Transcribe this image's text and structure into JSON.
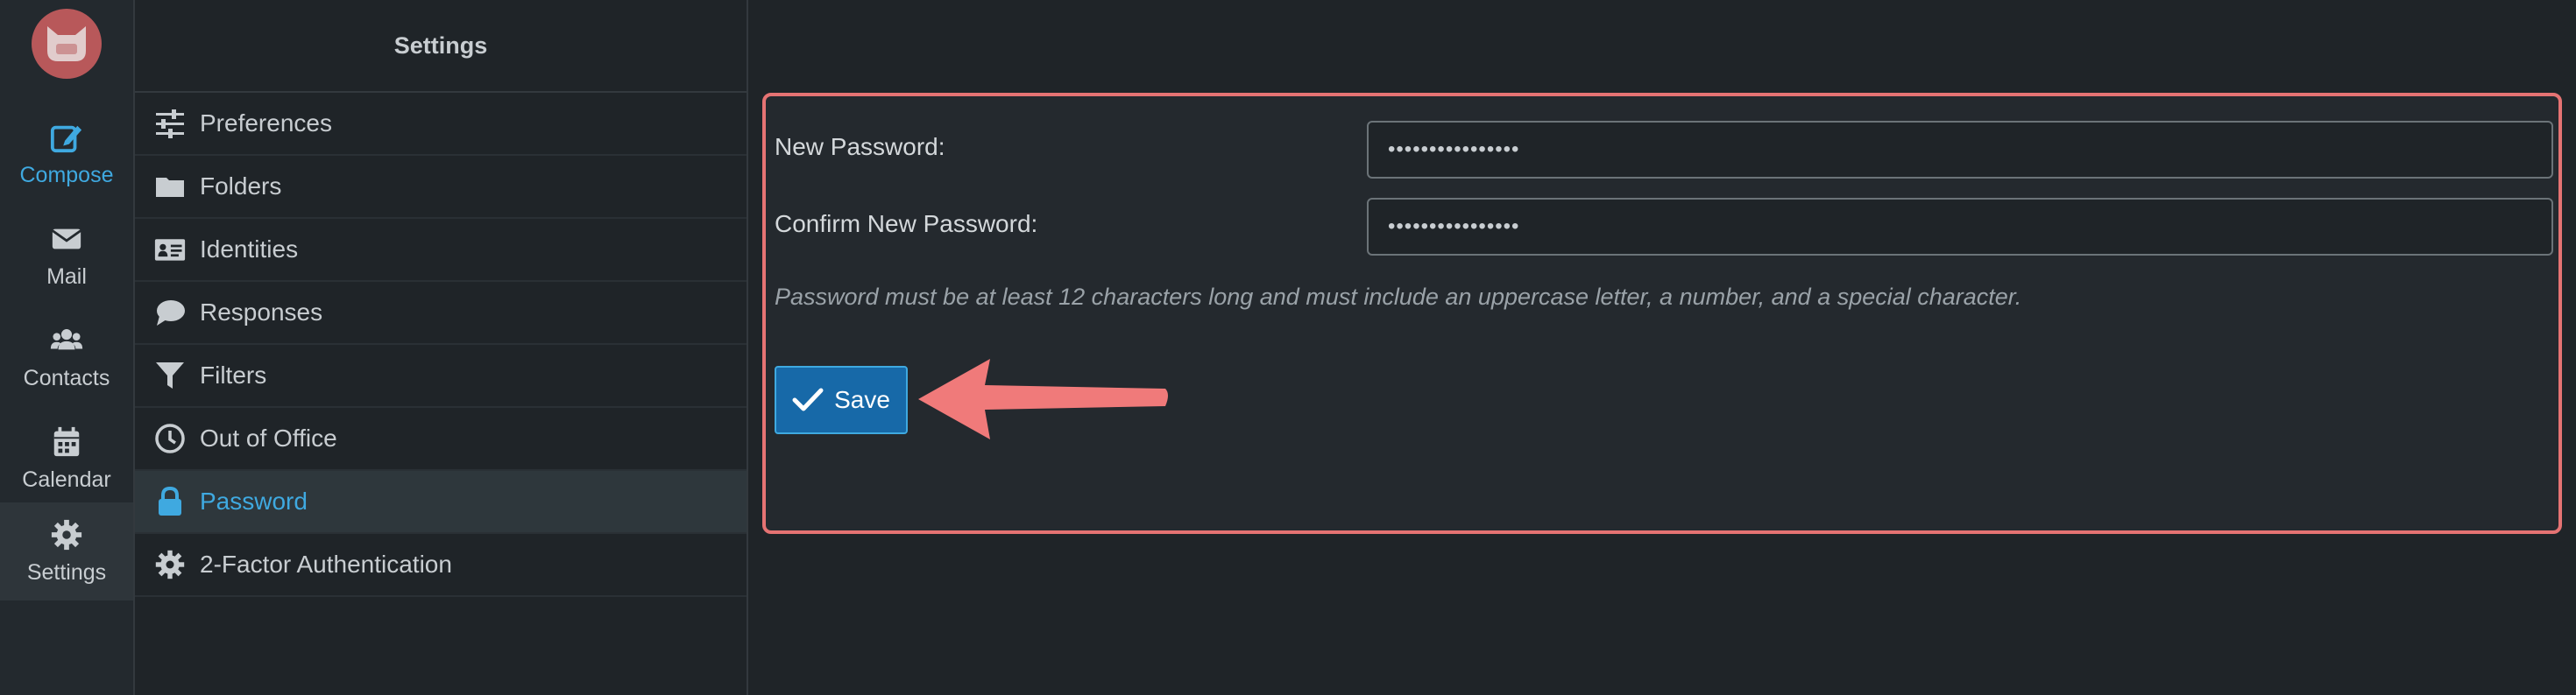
{
  "appnav": {
    "items": [
      {
        "label": "Compose",
        "icon": "compose-icon"
      },
      {
        "label": "Mail",
        "icon": "mail-icon"
      },
      {
        "label": "Contacts",
        "icon": "contacts-icon"
      },
      {
        "label": "Calendar",
        "icon": "calendar-icon"
      },
      {
        "label": "Settings",
        "icon": "gear-icon"
      }
    ]
  },
  "settings": {
    "title": "Settings",
    "items": [
      {
        "label": "Preferences",
        "icon": "sliders-icon"
      },
      {
        "label": "Folders",
        "icon": "folder-icon"
      },
      {
        "label": "Identities",
        "icon": "id-card-icon"
      },
      {
        "label": "Responses",
        "icon": "comment-icon"
      },
      {
        "label": "Filters",
        "icon": "filter-icon"
      },
      {
        "label": "Out of Office",
        "icon": "clock-icon"
      },
      {
        "label": "Password",
        "icon": "lock-icon"
      },
      {
        "label": "2-Factor Authentication",
        "icon": "gear-icon"
      }
    ],
    "active": "Password"
  },
  "form": {
    "new_password_label": "New Password:",
    "new_password_value": "••••••••••••••••",
    "confirm_password_label": "Confirm New Password:",
    "confirm_password_value": "••••••••••••••••",
    "hint": "Password must be at least 12 characters long and must include an uppercase letter, a number, and a special character.",
    "save_label": "Save"
  },
  "colors": {
    "accent": "#3fa9e0",
    "highlight": "#e57373",
    "button": "#1769a8"
  }
}
